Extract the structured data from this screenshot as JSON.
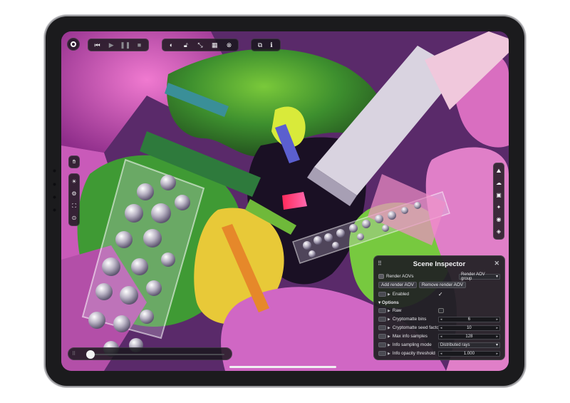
{
  "accent_color": "#0a84ff",
  "toolbar_top": {
    "record_icon": "record-icon",
    "playback": [
      "skip-back-icon",
      "play-icon",
      "pause-icon",
      "stop-icon"
    ],
    "tools": [
      "toggle-icon",
      "lock-icon",
      "expand-icon",
      "checker-icon",
      "close-circle-icon"
    ],
    "extras": [
      "snapshot-icon",
      "info-icon"
    ]
  },
  "left_toolbar": [
    "hand-icon",
    "sun-icon",
    "gear-icon",
    "crop-icon",
    "target-icon"
  ],
  "right_toolbar": [
    "mountain-icon",
    "weather-icon",
    "gallery-icon",
    "sparkle-icon",
    "camera-icon",
    "layers-icon"
  ],
  "inspector": {
    "title": "Scene Inspector",
    "render_aovs_label": "Render AOVs",
    "render_aov_group_value": "Render AOV group",
    "add_button": "Add render AOV",
    "remove_button": "Remove render AOV",
    "enabled_label": "Enabled",
    "enabled_check": "✓",
    "options_label": "▾ Options",
    "raw_label": "Raw",
    "cryptomatte_bins_label": "Cryptomatte bins",
    "cryptomatte_bins_value": "6",
    "cryptomatte_seed_label": "Cryptomatte seed factor",
    "cryptomatte_seed_value": "10",
    "max_info_samples_label": "Max info samples",
    "max_info_samples_value": "128",
    "info_sampling_mode_label": "Info sampling mode",
    "info_sampling_mode_value": "Distributed rays",
    "info_opacity_label": "Info opacity threshold",
    "info_opacity_value": "1.000"
  },
  "timeline": {
    "progress": 0.05
  }
}
